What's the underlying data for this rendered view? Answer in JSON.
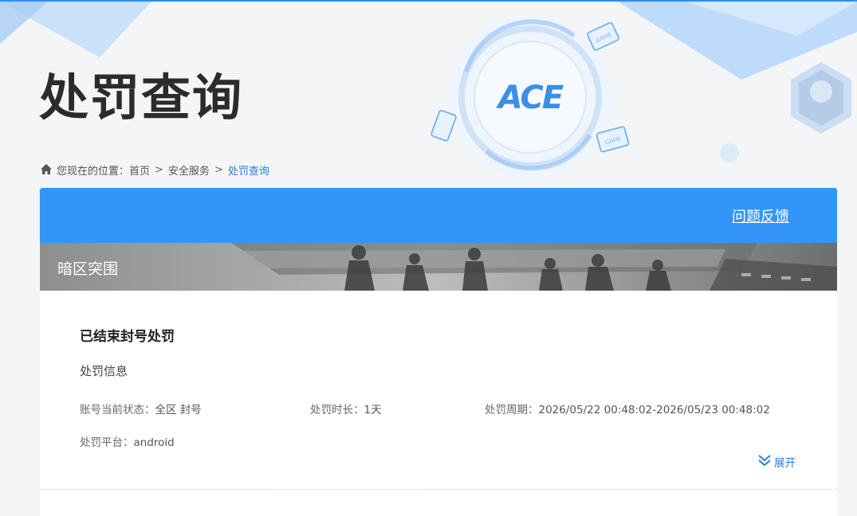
{
  "header": {
    "title": "处罚查询"
  },
  "breadcrumb": {
    "prefix": "您现在的位置：",
    "items": [
      "首页",
      "安全服务",
      "处罚查询"
    ],
    "separator": ">"
  },
  "toolbar": {
    "feedback_label": "问题反馈"
  },
  "game": {
    "name": "暗区突围"
  },
  "punishment": {
    "title": "已结束封号处罚",
    "section_label": "处罚信息",
    "status_label": "账号当前状态：",
    "status_value": "全区 封号",
    "duration_label": "处罚时长：",
    "duration_value": "1天",
    "period_label": "处罚周期：",
    "period_value": "2026/05/22 00:48:02-2026/05/23 00:48:02",
    "platform_label": "处罚平台：",
    "platform_value": "android",
    "expand_label": "展开"
  },
  "logo_text": "ACE",
  "colors": {
    "accent": "#3495f8",
    "link": "#2b7fd6",
    "top_bar": "#2f8ef0"
  },
  "icons": {
    "home": "home-icon",
    "expand": "double-chevron-down-icon"
  }
}
